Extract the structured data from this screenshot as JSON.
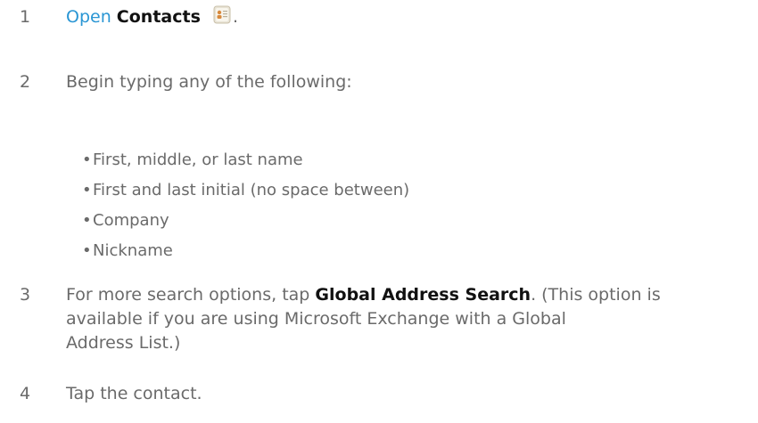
{
  "steps": [
    {
      "number": "1",
      "link_text": "Open",
      "bold_text": "Contacts",
      "icon": "contacts-app-icon",
      "suffix": "."
    },
    {
      "number": "2",
      "text": "Begin typing any of the following:",
      "bullets": [
        "First, middle, or last name",
        "First and last initial (no space between)",
        "Company",
        "Nickname"
      ]
    },
    {
      "number": "3",
      "prefix": "For more search options, tap",
      "bold_text": "Global Address Search",
      "suffix_line1": ". (This option is",
      "line2": "available if you are using Microsoft Exchange with a Global",
      "line3": "Address List.)"
    },
    {
      "number": "4",
      "text": "Tap the contact."
    }
  ],
  "colors": {
    "body_text": "#6a6a6a",
    "link": "#2a96d4",
    "bold": "#111111"
  }
}
